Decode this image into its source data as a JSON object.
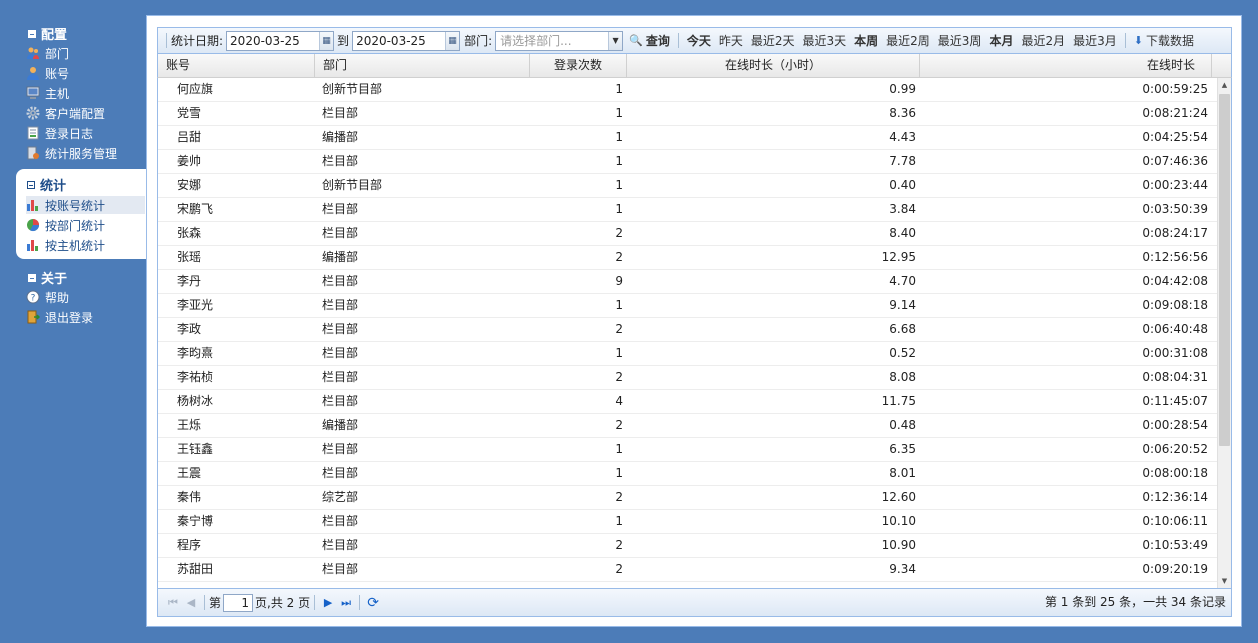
{
  "sidebar": {
    "config_title": "配置",
    "config_items": [
      {
        "label": "部门",
        "icon": "users-icon"
      },
      {
        "label": "账号",
        "icon": "user-icon"
      },
      {
        "label": "主机",
        "icon": "computer-icon"
      },
      {
        "label": "客户端配置",
        "icon": "gear-icon"
      },
      {
        "label": "登录日志",
        "icon": "log-icon"
      },
      {
        "label": "统计服务管理",
        "icon": "server-icon"
      }
    ],
    "stat_title": "统计",
    "stat_items": [
      {
        "label": "按账号统计",
        "icon": "bar-chart-icon"
      },
      {
        "label": "按部门统计",
        "icon": "pie-chart-icon"
      },
      {
        "label": "按主机统计",
        "icon": "bar-chart-icon"
      }
    ],
    "about_title": "关于",
    "about_items": [
      {
        "label": "帮助",
        "icon": "help-icon"
      },
      {
        "label": "退出登录",
        "icon": "logout-icon"
      }
    ]
  },
  "toolbar": {
    "date_label": "统计日期:",
    "start_date": "2020-03-25",
    "to_label": "到",
    "end_date": "2020-03-25",
    "dept_label": "部门:",
    "dept_placeholder": "请选择部门...",
    "query_label": "查询",
    "quick_ranges": [
      {
        "label": "今天",
        "bold": true
      },
      {
        "label": "昨天",
        "bold": false
      },
      {
        "label": "最近2天",
        "bold": false
      },
      {
        "label": "最近3天",
        "bold": false
      },
      {
        "label": "本周",
        "bold": true
      },
      {
        "label": "最近2周",
        "bold": false
      },
      {
        "label": "最近3周",
        "bold": false
      },
      {
        "label": "本月",
        "bold": true
      },
      {
        "label": "最近2月",
        "bold": false
      },
      {
        "label": "最近3月",
        "bold": false
      }
    ],
    "download_label": "下载数据"
  },
  "grid": {
    "columns": [
      "账号",
      "部门",
      "登录次数",
      "在线时长（小时）",
      "在线时长"
    ],
    "rows": [
      [
        "何应旗",
        "创新节目部",
        "1",
        "0.99",
        "0:00:59:25"
      ],
      [
        "党雪",
        "栏目部",
        "1",
        "8.36",
        "0:08:21:24"
      ],
      [
        "吕甜",
        "编播部",
        "1",
        "4.43",
        "0:04:25:54"
      ],
      [
        "姜帅",
        "栏目部",
        "1",
        "7.78",
        "0:07:46:36"
      ],
      [
        "安娜",
        "创新节目部",
        "1",
        "0.40",
        "0:00:23:44"
      ],
      [
        "宋鹏飞",
        "栏目部",
        "1",
        "3.84",
        "0:03:50:39"
      ],
      [
        "张森",
        "栏目部",
        "2",
        "8.40",
        "0:08:24:17"
      ],
      [
        "张瑶",
        "编播部",
        "2",
        "12.95",
        "0:12:56:56"
      ],
      [
        "李丹",
        "栏目部",
        "9",
        "4.70",
        "0:04:42:08"
      ],
      [
        "李亚光",
        "栏目部",
        "1",
        "9.14",
        "0:09:08:18"
      ],
      [
        "李政",
        "栏目部",
        "2",
        "6.68",
        "0:06:40:48"
      ],
      [
        "李昀熹",
        "栏目部",
        "1",
        "0.52",
        "0:00:31:08"
      ],
      [
        "李祐桢",
        "栏目部",
        "2",
        "8.08",
        "0:08:04:31"
      ],
      [
        "杨树冰",
        "栏目部",
        "4",
        "11.75",
        "0:11:45:07"
      ],
      [
        "王烁",
        "编播部",
        "2",
        "0.48",
        "0:00:28:54"
      ],
      [
        "王钰鑫",
        "栏目部",
        "1",
        "6.35",
        "0:06:20:52"
      ],
      [
        "王震",
        "栏目部",
        "1",
        "8.01",
        "0:08:00:18"
      ],
      [
        "秦伟",
        "综艺部",
        "2",
        "12.60",
        "0:12:36:14"
      ],
      [
        "秦宁博",
        "栏目部",
        "1",
        "10.10",
        "0:10:06:11"
      ],
      [
        "程序",
        "栏目部",
        "2",
        "10.90",
        "0:10:53:49"
      ],
      [
        "苏甜田",
        "栏目部",
        "2",
        "9.34",
        "0:09:20:19"
      ]
    ]
  },
  "paging": {
    "page_prefix": "第",
    "current_page": "1",
    "page_suffix": "页,共 2 页",
    "info": "第 1 条到 25 条，一共 34 条记录"
  }
}
